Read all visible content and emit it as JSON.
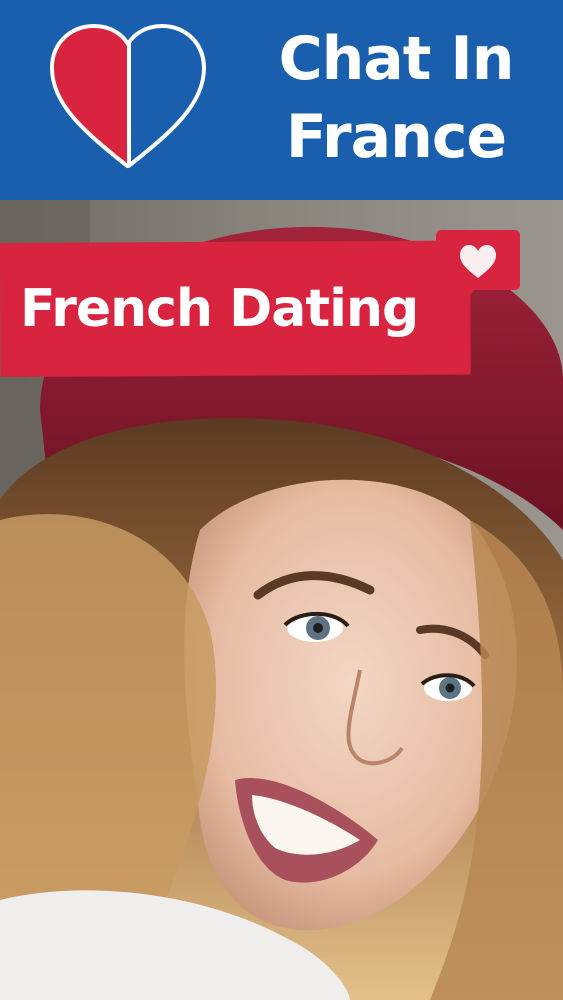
{
  "header": {
    "app_title": "Chat In\nFrance",
    "logo_icon": "heart-french-flag-icon",
    "background_color": "#1a5fae"
  },
  "banner": {
    "text": "French Dating",
    "background_color": "#d8243e",
    "badge_icon": "heart-chat-bubble-icon"
  },
  "photo": {
    "icon": "smiling-woman-red-beret-photo"
  }
}
